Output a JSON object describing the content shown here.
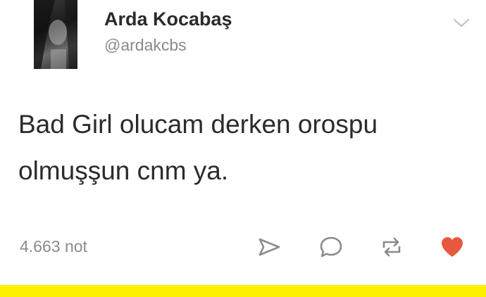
{
  "post": {
    "author": {
      "name": "Arda Kocabaş",
      "handle": "@ardakcbs"
    },
    "text": "Bad Girl olucam derken orospu olmuşşun cnm ya.",
    "notes": "4.663 not"
  },
  "icons": {
    "menu": "chevron-down-icon",
    "share": "send-icon",
    "reply": "chat-bubble-icon",
    "reblog": "reblog-icon",
    "like": "heart-icon"
  },
  "colors": {
    "text": "#2b2b2b",
    "muted": "#8a8a8a",
    "like": "#e8583e",
    "highlight_bar": "#fff200"
  }
}
